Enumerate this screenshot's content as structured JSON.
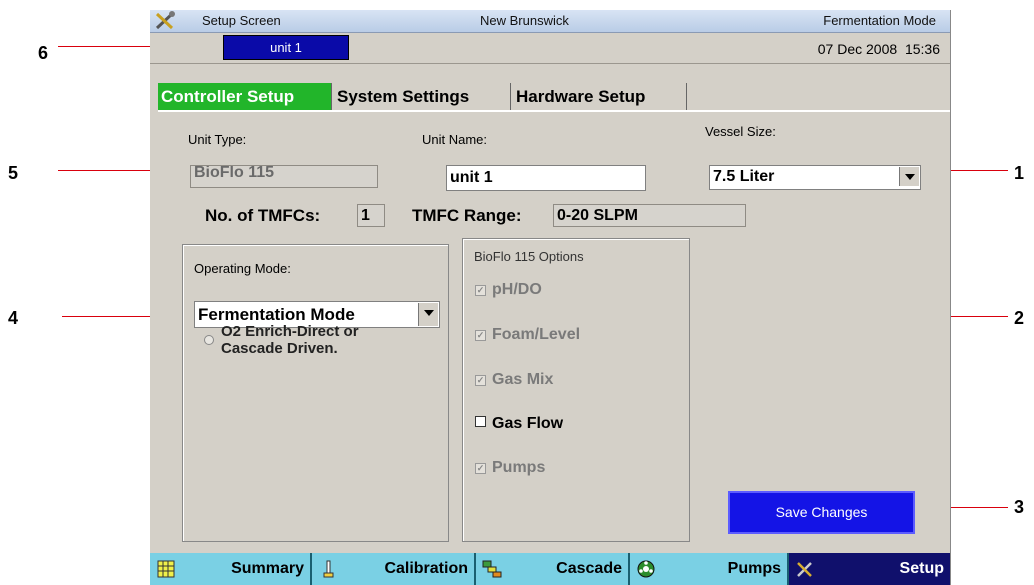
{
  "window": {
    "title": "Setup Screen",
    "location": "New Brunswick",
    "mode": "Fermentation Mode"
  },
  "header": {
    "unit_tab": "unit 1",
    "date": "07 Dec 2008",
    "time": "15:36"
  },
  "tabs": [
    {
      "label": "Controller Setup",
      "active": true
    },
    {
      "label": "System Settings",
      "active": false
    },
    {
      "label": "Hardware Setup",
      "active": false
    }
  ],
  "form": {
    "unit_type_label": "Unit Type:",
    "unit_type_value": "BioFlo 115",
    "unit_name_label": "Unit Name:",
    "unit_name_value": "unit 1",
    "vessel_size_label": "Vessel Size:",
    "vessel_size_value": "7.5 Liter",
    "tmfc_count_label": "No. of TMFCs:",
    "tmfc_count_value": "1",
    "tmfc_range_label": "TMFC Range:",
    "tmfc_range_value": "0-20 SLPM"
  },
  "operating_mode": {
    "label": "Operating Mode:",
    "value": "Fermentation Mode",
    "radio_line1": "O2 Enrich-Direct or",
    "radio_line2": "Cascade Driven."
  },
  "options": {
    "title": "BioFlo 115 Options",
    "items": [
      {
        "label": "pH/DO",
        "checked": true,
        "enabled": false
      },
      {
        "label": "Foam/Level",
        "checked": true,
        "enabled": false
      },
      {
        "label": "Gas Mix",
        "checked": true,
        "enabled": false
      },
      {
        "label": "Gas Flow",
        "checked": false,
        "enabled": true
      },
      {
        "label": "Pumps",
        "checked": true,
        "enabled": false
      }
    ]
  },
  "save_button": "Save Changes",
  "bottom_nav": [
    {
      "label": "Summary",
      "icon": "grid-icon"
    },
    {
      "label": "Calibration",
      "icon": "probe-icon"
    },
    {
      "label": "Cascade",
      "icon": "cascade-icon"
    },
    {
      "label": "Pumps",
      "icon": "pump-icon"
    },
    {
      "label": "Setup",
      "icon": "tools-icon",
      "active": true
    }
  ],
  "callouts": [
    "1",
    "2",
    "3",
    "4",
    "5",
    "6"
  ],
  "colors": {
    "active_tab": "#22b52a",
    "unit_tab": "#0a0aa8",
    "save_button": "#1414e6",
    "nav_bar": "#7ad0e4",
    "nav_active": "#10106c",
    "callout_line": "#d9000d"
  }
}
